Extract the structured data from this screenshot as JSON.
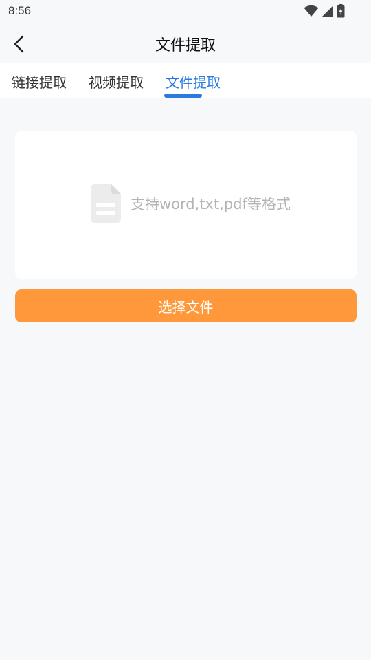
{
  "status_bar": {
    "time": "8:56"
  },
  "header": {
    "title": "文件提取"
  },
  "tabs": [
    {
      "label": "链接提取",
      "active": false
    },
    {
      "label": "视频提取",
      "active": false
    },
    {
      "label": "文件提取",
      "active": true
    }
  ],
  "upload": {
    "hint": "支持word,txt,pdf等格式"
  },
  "actions": {
    "select_file_label": "选择文件"
  },
  "colors": {
    "accent_blue": "#2a7ae2",
    "button_orange": "#ff983a",
    "background": "#f7f8fa",
    "hint_gray": "#b4b4b4"
  },
  "icons": [
    "back-arrow-icon",
    "wifi-icon",
    "signal-icon",
    "battery-charging-icon",
    "document-icon"
  ]
}
